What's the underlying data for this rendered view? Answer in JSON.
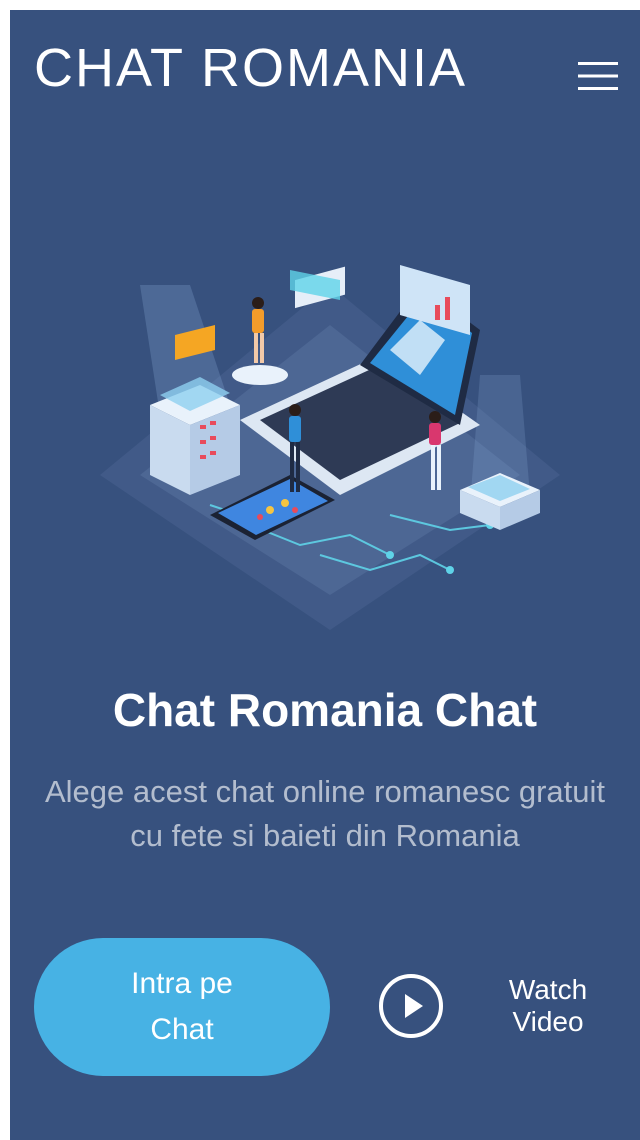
{
  "header": {
    "logo_text": "CHAT ROMANIA",
    "menu_icon": "hamburger-menu-icon"
  },
  "hero": {
    "illustration": "isometric-network-illustration",
    "title": "Chat Romania Chat",
    "subtitle": "Alege acest chat online romanesc gratuit cu fete si baieti din Romania",
    "cta_label": "Intra pe Chat",
    "watch_video_label": "Watch Video",
    "watch_video_icon": "play-circle-icon"
  },
  "colors": {
    "background": "#37517e",
    "cta": "#47b2e4",
    "text": "#ffffff"
  }
}
